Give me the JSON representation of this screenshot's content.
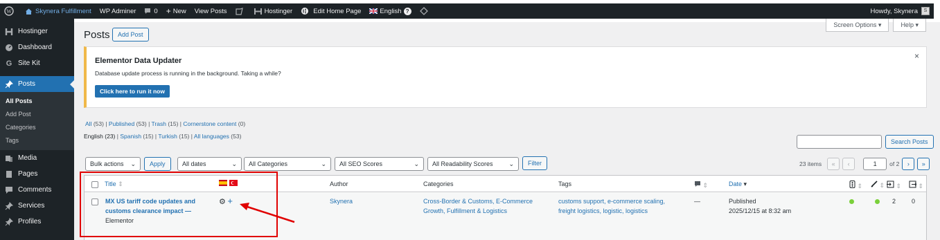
{
  "adminbar": {
    "site_name": "Skynera Fulfillment",
    "wp_adminer": "WP Adminer",
    "comments_count": "0",
    "new_label": "New",
    "view_posts": "View Posts",
    "hostinger": "Hostinger",
    "edit_home": "Edit Home Page",
    "language": "English",
    "howdy": "Howdy, Skynera"
  },
  "sidebar": {
    "items": [
      {
        "label": "Hostinger",
        "icon": "hostinger-icon"
      },
      {
        "label": "Dashboard",
        "icon": "dashboard-icon"
      },
      {
        "label": "Site Kit",
        "icon": "sitekit-icon"
      },
      {
        "label": "Posts",
        "icon": "pin-icon"
      },
      {
        "label": "Media",
        "icon": "media-icon"
      },
      {
        "label": "Pages",
        "icon": "pages-icon"
      },
      {
        "label": "Comments",
        "icon": "comments-icon"
      },
      {
        "label": "Services",
        "icon": "pin-icon"
      },
      {
        "label": "Profiles",
        "icon": "pin-icon"
      }
    ],
    "posts_sub": [
      "All Posts",
      "Add Post",
      "Categories",
      "Tags"
    ]
  },
  "screen_options": "Screen Options",
  "help": "Help",
  "page_title": "Posts",
  "add_post": "Add Post",
  "notice": {
    "title": "Elementor Data Updater",
    "text": "Database update process is running in the background. Taking a while?",
    "button": "Click here to run it now",
    "close": "×"
  },
  "status_links": {
    "all": "All",
    "all_count": "(53)",
    "published": "Published",
    "published_count": "(53)",
    "trash": "Trash",
    "trash_count": "(15)",
    "cornerstone": "Cornerstone content",
    "cornerstone_count": "(0)"
  },
  "lang_links": {
    "english": "English",
    "english_count": "(23)",
    "spanish": "Spanish",
    "spanish_count": "(15)",
    "turkish": "Turkish",
    "turkish_count": "(15)",
    "all_languages": "All languages",
    "all_count": "(53)"
  },
  "search_button": "Search Posts",
  "filters": {
    "bulk": "Bulk actions",
    "apply": "Apply",
    "dates": "All dates",
    "categories": "All Categories",
    "seo": "All SEO Scores",
    "readability": "All Readability Scores",
    "filter": "Filter"
  },
  "pagination": {
    "items": "23 items",
    "first": "«",
    "prev": "‹",
    "current": "1",
    "of": "of 2",
    "next": "›",
    "last": "»"
  },
  "table": {
    "headers": {
      "title": "Title",
      "author": "Author",
      "categories": "Categories",
      "tags": "Tags",
      "date": "Date"
    },
    "row": {
      "title_line1": "MX US tariff code updates and",
      "title_line2": "customs clearance impact —",
      "editor": "Elementor",
      "author": "Skynera",
      "categories_line1": "Cross-Border & Customs, E-Commerce",
      "categories_line2": "Growth, Fulfillment & Logistics",
      "tags_line1": "customs support, e-commerce scaling,",
      "tags_line2": "freight logistics, logistic, logistics",
      "comments": "—",
      "status": "Published",
      "date": "2025/12/15 at 8:32 am",
      "links_in": "2",
      "links_out": "0"
    }
  },
  "colors": {
    "admin_bg": "#1d2327",
    "accent": "#2271b1",
    "highlight": "#e00000",
    "seo_dot": "#7ad03a",
    "notice_border": "#f0b849"
  }
}
